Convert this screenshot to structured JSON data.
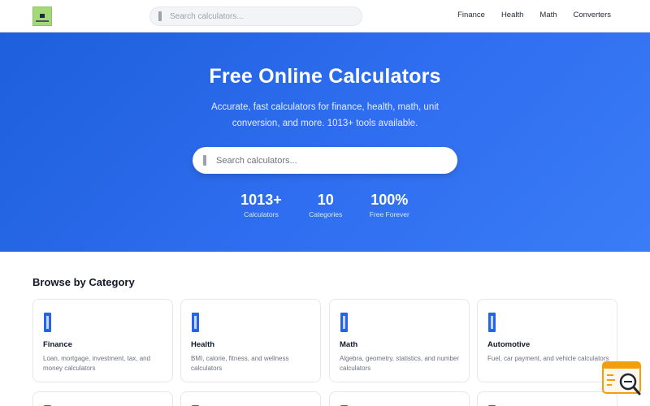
{
  "header": {
    "logo_icon": "calculator-logo-icon",
    "search_placeholder": "Search calculators...",
    "nav": [
      "Finance",
      "Health",
      "Math",
      "Converters"
    ]
  },
  "hero": {
    "title": "Free Online Calculators",
    "subtitle": "Accurate, fast calculators for finance, health, math, unit conversion, and more. 1013+ tools available.",
    "search_placeholder": "Search calculators...",
    "stats": [
      {
        "value": "1013+",
        "label": "Calculators"
      },
      {
        "value": "10",
        "label": "Categories"
      },
      {
        "value": "100%",
        "label": "Free Forever"
      }
    ]
  },
  "categories": {
    "title": "Browse by Category",
    "items": [
      {
        "name": "Finance",
        "description": "Loan, mortgage, investment, tax, and money calculators",
        "icon": "calculator-icon"
      },
      {
        "name": "Health",
        "description": "BMI, calorie, fitness, and wellness calculators",
        "icon": "calculator-icon"
      },
      {
        "name": "Math",
        "description": "Algebra, geometry, statistics, and number calculators",
        "icon": "calculator-icon"
      },
      {
        "name": "Automotive",
        "description": "Fuel, car payment, and vehicle calculators",
        "icon": "calculator-icon"
      }
    ]
  },
  "colors": {
    "brand_blue": "#2563eb",
    "hero_gradient_start": "#1d5fdc",
    "hero_gradient_end": "#3a7cf6",
    "widget_orange": "#f59e0b"
  },
  "widget": {
    "icon": "search-chat-widget-icon"
  }
}
